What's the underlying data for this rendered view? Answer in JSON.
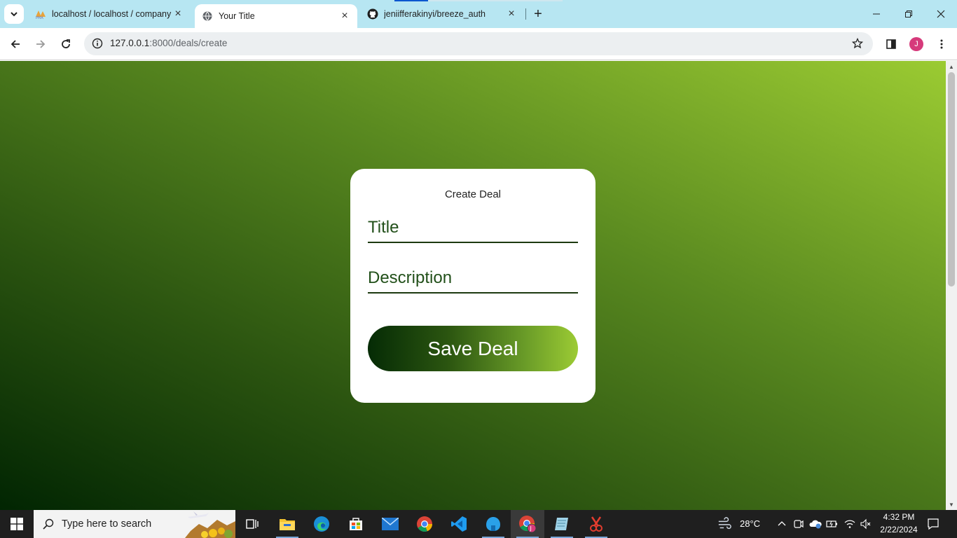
{
  "tabs": [
    {
      "label": "localhost / localhost / company",
      "favicon": "phpmyadmin-icon",
      "active": false
    },
    {
      "label": "Your Title",
      "favicon": "globe-icon",
      "active": true
    },
    {
      "label": "jeniifferakinyi/breeze_auth",
      "favicon": "github-icon",
      "active": false
    }
  ],
  "address_bar": {
    "host": "127.0.0.1",
    "path": ":8000/deals/create"
  },
  "profile": {
    "initial": "J",
    "color": "#d63a7b"
  },
  "form": {
    "title": "Create Deal",
    "title_placeholder": "Title",
    "description_placeholder": "Description",
    "submit_label": "Save Deal"
  },
  "taskbar": {
    "search_placeholder": "Type here to search",
    "apps": [
      "task-view-icon",
      "file-explorer-icon",
      "edge-icon",
      "store-icon",
      "mail-icon",
      "chrome-icon",
      "vscode-icon",
      "app-icon",
      "chrome-profile-icon",
      "notepad-icon",
      "snipping-tool-icon"
    ],
    "weather": "28°C",
    "time": "4:32 PM",
    "date": "2/22/2024"
  },
  "colors": {
    "tab_strip": "#b7e6f2",
    "gradient_dark": "#012502",
    "gradient_light": "#9bcb32",
    "field_text": "#22501a"
  }
}
